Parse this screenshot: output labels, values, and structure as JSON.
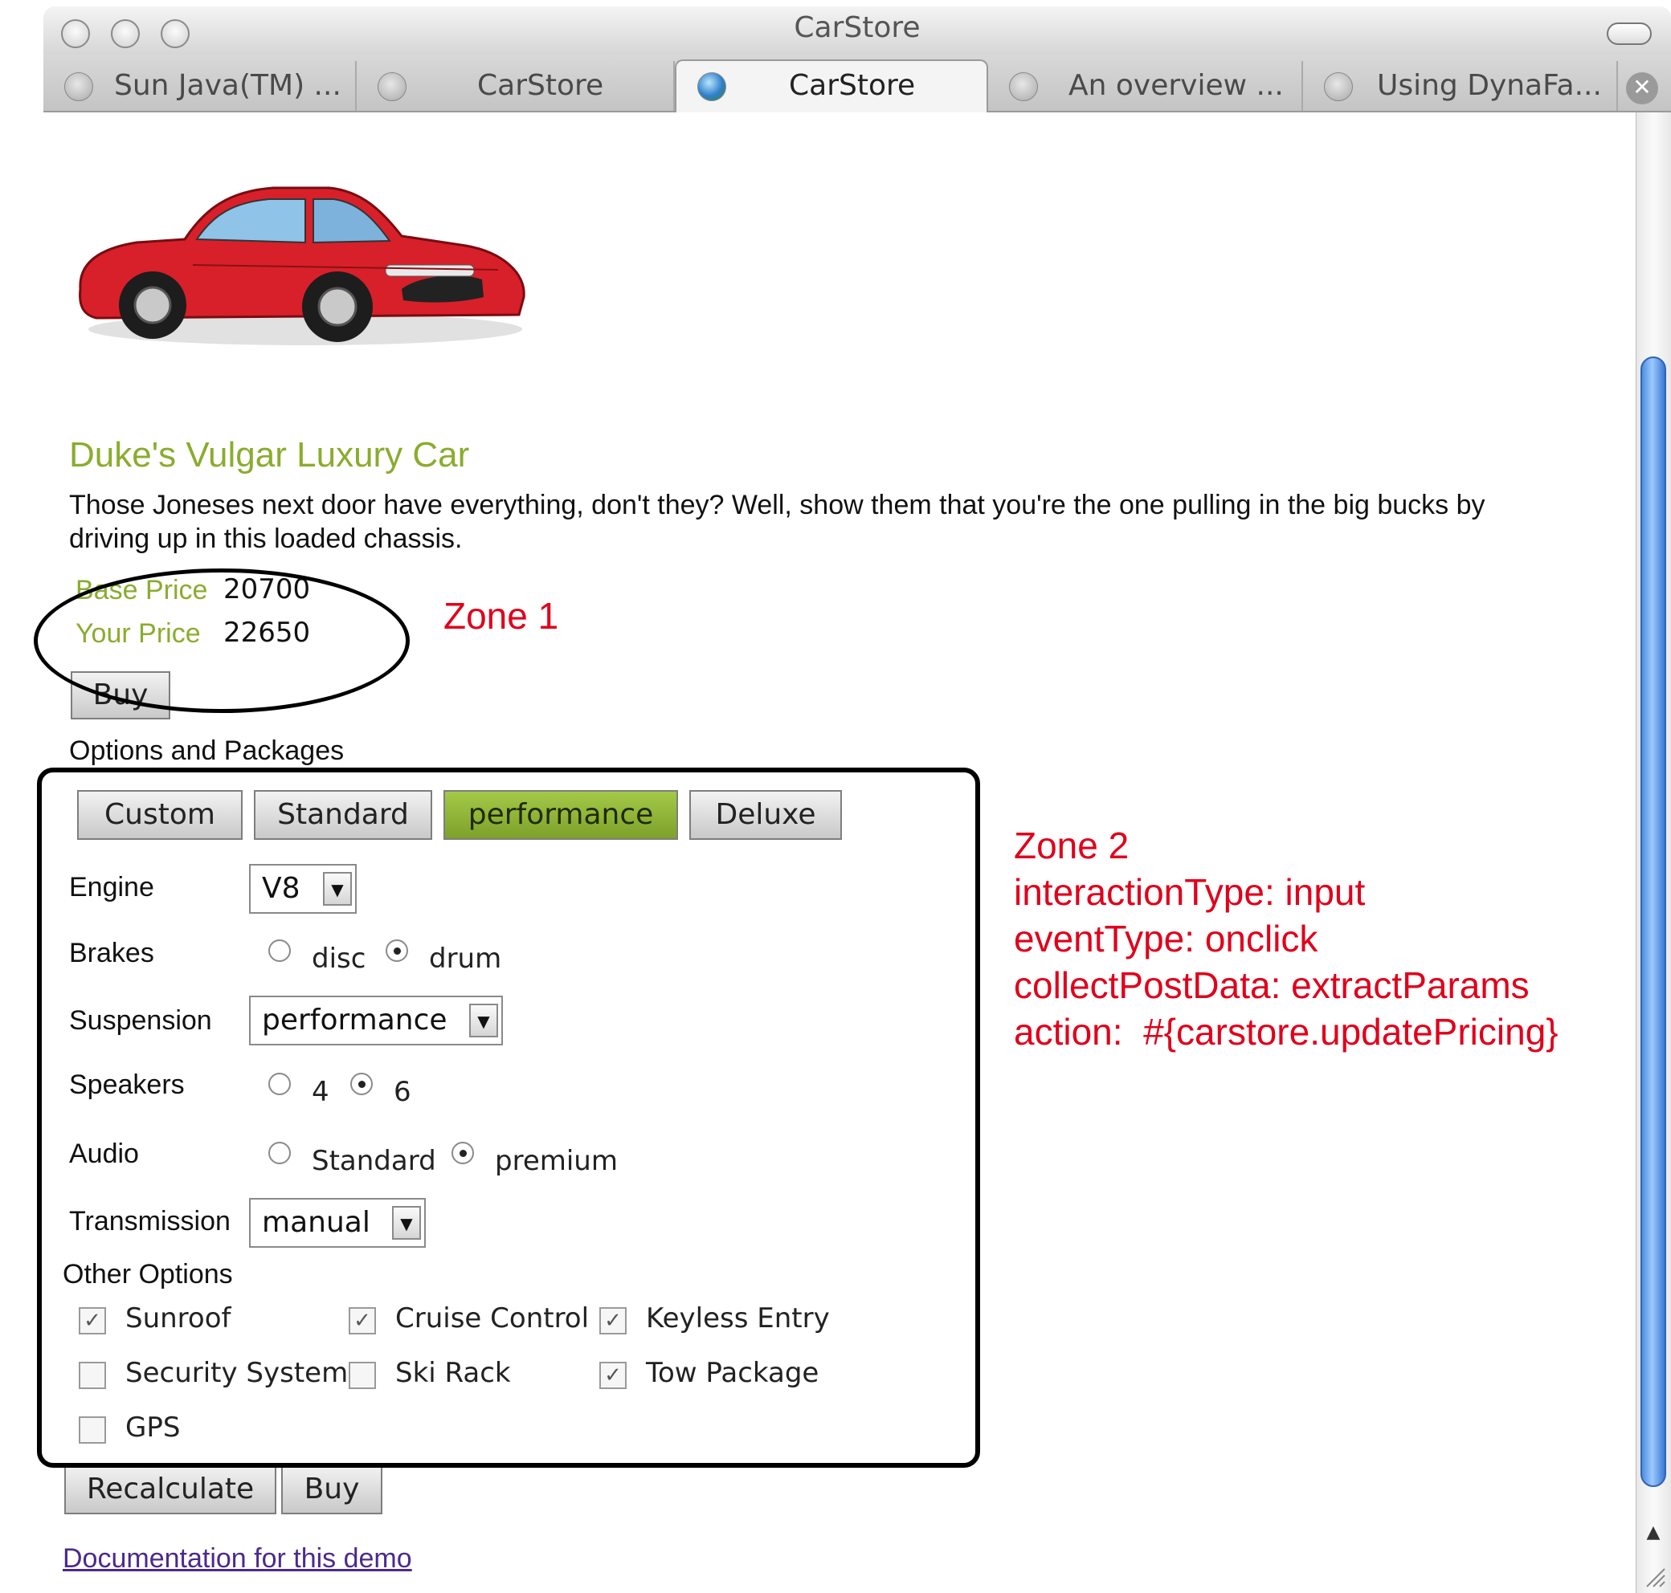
{
  "window": {
    "title": "CarStore"
  },
  "tabs": [
    {
      "label": "Sun Java(TM) ..."
    },
    {
      "label": "CarStore"
    },
    {
      "label": "CarStore"
    },
    {
      "label": "An overview ..."
    },
    {
      "label": "Using DynaFa..."
    }
  ],
  "car": {
    "title": "Duke's Vulgar Luxury Car",
    "description_line1": "Those Joneses next door have everything, don't they? Well, show them that you're the one pulling in the big bucks by",
    "description_line2": "driving up in this loaded chassis.",
    "base_price_label": "Base Price",
    "base_price": "20700",
    "your_price_label": "Your Price",
    "your_price": "22650",
    "body_color": "#d8202a"
  },
  "buy_top_label": "Buy",
  "options_heading": "Options and Packages",
  "packages": [
    {
      "label": "Custom",
      "selected": false
    },
    {
      "label": "Standard",
      "selected": false
    },
    {
      "label": "performance",
      "selected": true
    },
    {
      "label": "Deluxe",
      "selected": false
    }
  ],
  "form": {
    "engine": {
      "label": "Engine",
      "value": "V8"
    },
    "brakes": {
      "label": "Brakes",
      "options": [
        "disc",
        "drum"
      ],
      "selected": "drum"
    },
    "suspension": {
      "label": "Suspension",
      "value": "performance"
    },
    "speakers": {
      "label": "Speakers",
      "options": [
        "4",
        "6"
      ],
      "selected": "6"
    },
    "audio": {
      "label": "Audio",
      "options": [
        "Standard",
        "premium"
      ],
      "selected": "premium"
    },
    "transmission": {
      "label": "Transmission",
      "value": "manual"
    },
    "other_options_label": "Other Options",
    "other_options": [
      {
        "label": "Sunroof",
        "checked": true
      },
      {
        "label": "Cruise Control",
        "checked": true
      },
      {
        "label": "Keyless Entry",
        "checked": true
      },
      {
        "label": "Security System",
        "checked": false
      },
      {
        "label": "Ski Rack",
        "checked": false
      },
      {
        "label": "Tow Package",
        "checked": true
      },
      {
        "label": "GPS",
        "checked": false
      }
    ]
  },
  "actions": {
    "recalculate": "Recalculate",
    "buy": "Buy"
  },
  "doc_link": "Documentation for this demo",
  "annotations": {
    "zone1": "Zone 1",
    "zone2_lines": [
      "Zone 2",
      "interactionType: input",
      "eventType: onclick",
      "collectPostData: extractParams",
      "action:  #{carstore.updatePricing}"
    ],
    "zone_color": "#e0001b"
  },
  "colors": {
    "accent_green": "#8aac2e",
    "link": "#4b2a8c"
  }
}
